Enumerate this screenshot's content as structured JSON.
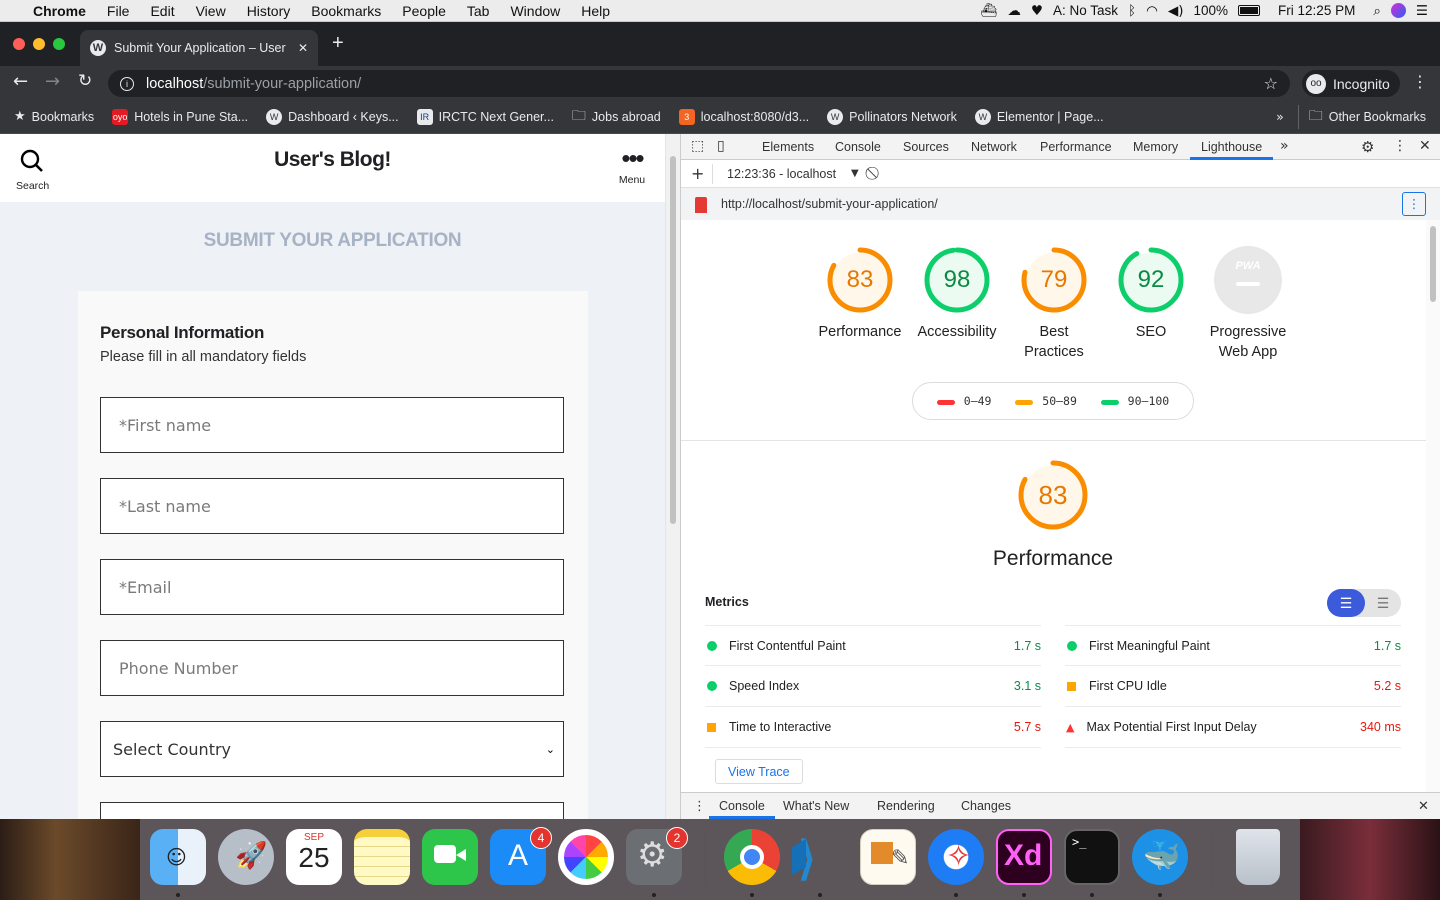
{
  "menubar": {
    "app": "Chrome",
    "items": [
      "File",
      "Edit",
      "View",
      "History",
      "Bookmarks",
      "People",
      "Tab",
      "Window",
      "Help"
    ],
    "status": {
      "task": "A: No Task",
      "battery": "100%",
      "clock": "Fri 12:25 PM"
    }
  },
  "browser": {
    "tab_title": "Submit Your Application – User",
    "url_host": "localhost",
    "url_path": "/submit-your-application/",
    "profile": "Incognito",
    "bookmarks": [
      {
        "label": "Bookmarks",
        "icon": "star-icon"
      },
      {
        "label": "Hotels in Pune Sta...",
        "icon": "oyo-icon"
      },
      {
        "label": "Dashboard ‹ Keys...",
        "icon": "wordpress-icon"
      },
      {
        "label": "IRCTC Next Gener...",
        "icon": "irctc-icon"
      },
      {
        "label": "Jobs abroad",
        "icon": "folder-icon"
      },
      {
        "label": "localhost:8080/d3...",
        "icon": "code-icon"
      },
      {
        "label": "Pollinators Network",
        "icon": "wordpress-icon"
      },
      {
        "label": "Elementor | Page...",
        "icon": "wordpress-icon"
      }
    ],
    "other_bookmarks": "Other Bookmarks"
  },
  "site": {
    "search_label": "Search",
    "title": "User's Blog!",
    "menu_label": "Menu",
    "heading": "SUBMIT YOUR APPLICATION",
    "section_title": "Personal Information",
    "section_subtitle": "Please fill in all mandatory fields",
    "fields": {
      "first_name": "*First name",
      "last_name": "*Last name",
      "email": "*Email",
      "phone": "Phone Number",
      "country": "Select Country"
    }
  },
  "devtools": {
    "tabs": [
      "Elements",
      "Console",
      "Sources",
      "Network",
      "Performance",
      "Memory",
      "Lighthouse"
    ],
    "active_tab": "Lighthouse",
    "report_label": "12:23:36 - localhost",
    "report_url": "http://localhost/submit-your-application/",
    "scores": [
      {
        "name": "Performance",
        "value": 83,
        "color": "#fa8c00"
      },
      {
        "name": "Accessibility",
        "value": 98,
        "color": "#0cce6b"
      },
      {
        "name": "Best Practices",
        "value": 79,
        "color": "#fa8c00"
      },
      {
        "name": "SEO",
        "value": 92,
        "color": "#0cce6b"
      }
    ],
    "pwa": {
      "name": "Progressive Web App",
      "badge": "PWA"
    },
    "legend": [
      {
        "range": "0–49",
        "color": "#ff3333"
      },
      {
        "range": "50–89",
        "color": "#ffa400"
      },
      {
        "range": "90–100",
        "color": "#0cce6b"
      }
    ],
    "perf_score": 83,
    "perf_title": "Performance",
    "metrics_title": "Metrics",
    "metrics": [
      {
        "name": "First Contentful Paint",
        "value": "1.7 s",
        "status": "pass",
        "color": "#0cce6b"
      },
      {
        "name": "First Meaningful Paint",
        "value": "1.7 s",
        "status": "pass",
        "color": "#0cce6b"
      },
      {
        "name": "Speed Index",
        "value": "3.1 s",
        "status": "pass",
        "color": "#0cce6b"
      },
      {
        "name": "First CPU Idle",
        "value": "5.2 s",
        "status": "average",
        "color": "#ffa400"
      },
      {
        "name": "Time to Interactive",
        "value": "5.7 s",
        "status": "average",
        "color": "#ffa400"
      },
      {
        "name": "Max Potential First Input Delay",
        "value": "340 ms",
        "status": "fail",
        "color": "#ff3333"
      }
    ],
    "view_trace": "View Trace",
    "drawer_tabs": [
      "Console",
      "What's New",
      "Rendering",
      "Changes"
    ]
  },
  "dock": {
    "calendar": {
      "month": "SEP",
      "day": "25"
    },
    "badges": {
      "app_store": "4",
      "system_prefs": "2"
    },
    "xd_label": "Xd",
    "terminal_prompt": ">_"
  }
}
